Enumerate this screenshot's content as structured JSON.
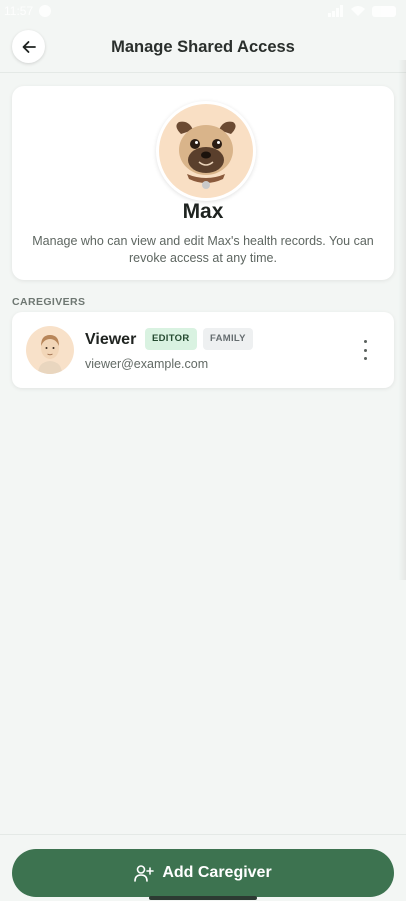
{
  "status_bar": {
    "time": "11:57"
  },
  "header": {
    "title": "Manage Shared Access",
    "back_icon": "arrow-left-icon"
  },
  "pet": {
    "name": "Max",
    "description": "Manage who can view and edit Max's health records. You can revoke access at any time.",
    "avatar_icon": "pug-avatar"
  },
  "caregivers_section": {
    "label": "CAREGIVERS",
    "items": [
      {
        "name": "Viewer",
        "role_badge": "EDITOR",
        "relation_badge": "FAMILY",
        "email": "viewer@example.com",
        "menu_icon": "more-vertical-icon"
      }
    ]
  },
  "add_button": {
    "label": "Add Caregiver",
    "icon": "user-plus-icon"
  },
  "colors": {
    "primary": "#3d7350",
    "editor_badge_bg": "#d9f2e1",
    "family_badge_bg": "#eef0f1",
    "avatar_bg": "#f9dfc4",
    "background": "#f3f6f4"
  }
}
